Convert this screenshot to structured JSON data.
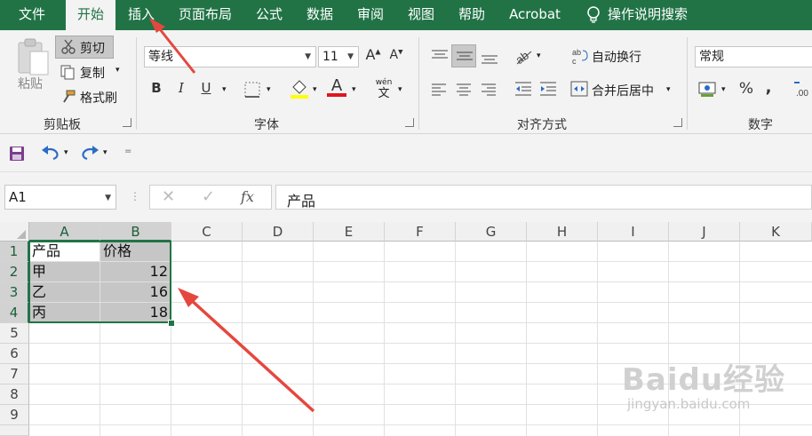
{
  "tabs": [
    {
      "label": "文件",
      "active": false
    },
    {
      "label": "开始",
      "active": true
    },
    {
      "label": "插入",
      "active": false
    },
    {
      "label": "页面布局",
      "active": false
    },
    {
      "label": "公式",
      "active": false
    },
    {
      "label": "数据",
      "active": false
    },
    {
      "label": "审阅",
      "active": false
    },
    {
      "label": "视图",
      "active": false
    },
    {
      "label": "帮助",
      "active": false
    },
    {
      "label": "Acrobat",
      "active": false
    }
  ],
  "tell_me": "操作说明搜索",
  "clipboard": {
    "paste": "粘贴",
    "cut": "剪切",
    "copy": "复制",
    "format_painter": "格式刷",
    "group_label": "剪贴板"
  },
  "font": {
    "name": "等线",
    "size": "11",
    "grow": "A",
    "shrink": "A",
    "bold": "B",
    "italic": "I",
    "underline": "U",
    "font_color_letter": "A",
    "phonetic_top": "wén",
    "phonetic_bottom": "文",
    "group_label": "字体"
  },
  "alignment": {
    "wrap_text": "自动换行",
    "merge_center": "合并后居中",
    "group_label": "对齐方式"
  },
  "number": {
    "format": "常规",
    "percent": "%",
    "comma": ",",
    "group_label": "数字"
  },
  "formula_bar": {
    "name_box": "A1",
    "fx": "fx",
    "content": "产品"
  },
  "columns": [
    "A",
    "B",
    "C",
    "D",
    "E",
    "F",
    "G",
    "H",
    "I",
    "J",
    "K"
  ],
  "rows": [
    "1",
    "2",
    "3",
    "4",
    "5",
    "6",
    "7",
    "8",
    "9"
  ],
  "cells": [
    [
      "产品",
      "价格"
    ],
    [
      "甲",
      "12"
    ],
    [
      "乙",
      "16"
    ],
    [
      "丙",
      "18"
    ]
  ],
  "watermark": {
    "brand": "Baidu经验",
    "url": "jingyan.baidu.com"
  },
  "colors": {
    "brand": "#217346",
    "arrow": "#e5473f",
    "selection": "#c6c6c6"
  }
}
